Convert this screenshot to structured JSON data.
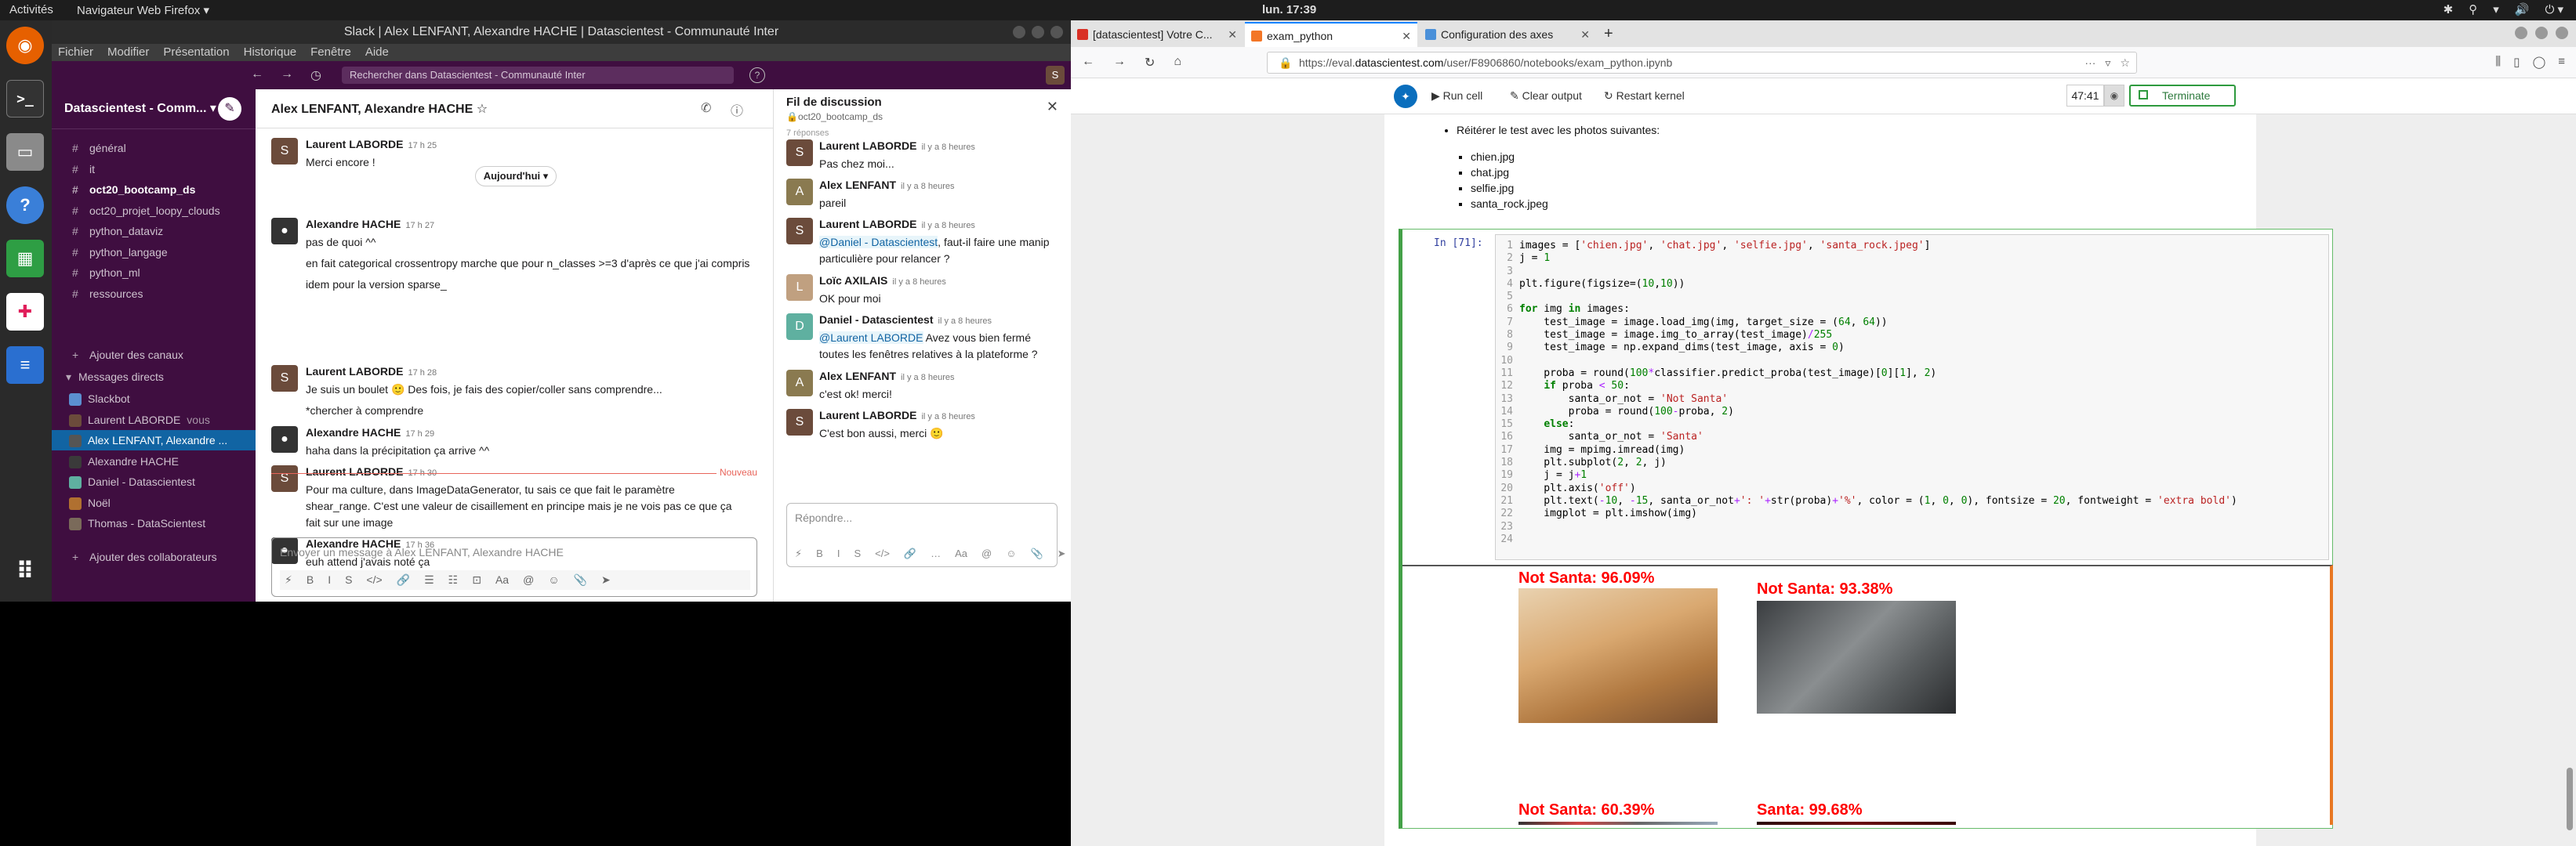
{
  "topbar": {
    "activities": "Activités",
    "app_menu": "Navigateur Web Firefox ▾",
    "clock": "lun. 17:39",
    "tray": [
      "✱",
      "⚲",
      "▾",
      "🔊",
      "⏻ ▾"
    ]
  },
  "dock": {
    "icons": [
      "firefox-icon",
      "terminal-icon",
      "files-icon",
      "help-icon",
      "spreadsheet-icon",
      "slack-icon",
      "document-icon",
      "apps-grid-icon"
    ]
  },
  "slack": {
    "window_title": "Slack | Alex LENFANT, Alexandre HACHE | Datascientest - Communauté Inter",
    "menu": [
      "Fichier",
      "Modifier",
      "Présentation",
      "Historique",
      "Fenêtre",
      "Aide"
    ],
    "search_placeholder": "Rechercher dans Datascientest - Communauté Inter",
    "help": "?",
    "user_avatar": "S",
    "workspace": "Datascientest - Comm...",
    "channels": [
      {
        "label": "général",
        "bold": false
      },
      {
        "label": "it",
        "bold": false
      },
      {
        "label": "oct20_bootcamp_ds",
        "bold": true
      },
      {
        "label": "oct20_projet_loopy_clouds",
        "bold": false
      },
      {
        "label": "python_dataviz",
        "bold": false
      },
      {
        "label": "python_langage",
        "bold": false
      },
      {
        "label": "python_ml",
        "bold": false
      },
      {
        "label": "ressources",
        "bold": false
      }
    ],
    "add_channels": "Ajouter des canaux",
    "dm_section": "Messages directs",
    "dms": [
      {
        "label": "Slackbot",
        "suffix": "",
        "active": false,
        "color": "#5b8fd0"
      },
      {
        "label": "Laurent LABORDE",
        "suffix": "vous",
        "active": false,
        "color": "#6b4b3b"
      },
      {
        "label": "Alex LENFANT, Alexandre ...",
        "suffix": "",
        "active": true,
        "color": "#555"
      },
      {
        "label": "Alexandre HACHE",
        "suffix": "",
        "active": false,
        "color": "#3a3a3a"
      },
      {
        "label": "Daniel - Datascientest",
        "suffix": "",
        "active": false,
        "color": "#5fb0a0"
      },
      {
        "label": "Noël",
        "suffix": "",
        "active": false,
        "color": "#b07030"
      },
      {
        "label": "Thomas - DataScientest",
        "suffix": "",
        "active": false,
        "color": "#7a6a5a"
      }
    ],
    "add_collaborators": "Ajouter des collaborateurs",
    "channel_title": "Alex LENFANT, Alexandre HACHE",
    "day_pill": "Aujourd'hui ▾",
    "messages": [
      {
        "name": "Laurent LABORDE",
        "time": "17 h 25",
        "lines": [
          "Merci encore !"
        ],
        "avatar": "S",
        "color": "#6b4b3b"
      },
      {
        "name": "Alexandre HACHE",
        "time": "17 h 27",
        "lines": [
          "pas de quoi ^^",
          "",
          "en fait categorical crossentropy marche que pour n_classes >=3 d'après ce que j'ai compris",
          "",
          "idem pour la version sparse_"
        ],
        "avatar": "●",
        "color": "#333"
      },
      {
        "name": "Laurent LABORDE",
        "time": "17 h 28",
        "lines": [
          "Je suis un boulet 🙂 Des fois, je fais des copier/coller sans comprendre...",
          "",
          "*chercher à comprendre"
        ],
        "avatar": "S",
        "color": "#6b4b3b"
      },
      {
        "name": "Alexandre HACHE",
        "time": "17 h 29",
        "lines": [
          "haha dans la précipitation ça arrive ^^"
        ],
        "avatar": "●",
        "color": "#333"
      },
      {
        "name": "Laurent LABORDE",
        "time": "17 h 30",
        "lines": [
          "Pour ma culture, dans ImageDataGenerator, tu sais ce que fait le paramètre",
          "shear_range. C'est une valeur de cisaillement en principe mais je ne vois pas ce que ça",
          "fait sur une image"
        ],
        "avatar": "S",
        "color": "#6b4b3b"
      },
      {
        "name": "Alexandre HACHE",
        "time": "17 h 36",
        "lines": [
          "euh attend j'avais noté ça"
        ],
        "avatar": "●",
        "color": "#333"
      }
    ],
    "new_label": "Nouveau",
    "composer_placeholder": "Envoyer un message à Alex LENFANT, Alexandre HACHE",
    "composer_tools": [
      "⚡",
      "B",
      "I",
      "S",
      "</>",
      "🔗",
      "☰",
      "☷",
      "⊡",
      "Aa",
      "@",
      "☺",
      "📎",
      "➤"
    ],
    "thread_title": "Fil de discussion",
    "thread_channel": "🔒oct20_bootcamp_ds",
    "thread_replies": "7 réponses",
    "thread": [
      {
        "name": "Laurent LABORDE",
        "time": "il y a 8 heures",
        "text": "Pas chez moi...",
        "avatar": "S",
        "color": "#6b4b3b"
      },
      {
        "name": "Alex LENFANT",
        "time": "il y a 8 heures",
        "text": "pareil",
        "avatar": "A",
        "color": "#8a7a50"
      },
      {
        "name": "Laurent LABORDE",
        "time": "il y a 8 heures",
        "mention": "@Daniel - Datascientest",
        "text": ", faut-il faire une manip particulière pour relancer ?",
        "avatar": "S",
        "color": "#6b4b3b"
      },
      {
        "name": "Loïc AXILAIS",
        "time": "il y a 8 heures",
        "text": "OK pour moi",
        "avatar": "L",
        "color": "#c0a080"
      },
      {
        "name": "Daniel - Datascientest",
        "time": "il y a 8 heures",
        "mention": "@Laurent LABORDE",
        "text": " Avez vous bien fermé toutes les fenêtres relatives à la plateforme ?",
        "avatar": "D",
        "color": "#5fb0a0"
      },
      {
        "name": "Alex LENFANT",
        "time": "il y a 8 heures",
        "text": "c'est ok! merci!",
        "avatar": "A",
        "color": "#8a7a50"
      },
      {
        "name": "Laurent LABORDE",
        "time": "il y a 8 heures",
        "text": "C'est bon aussi, merci 🙂",
        "avatar": "S",
        "color": "#6b4b3b"
      }
    ],
    "reply_placeholder": "Répondre..."
  },
  "firefox": {
    "tabs": [
      {
        "label": "[datascientest] Votre C...",
        "active": false,
        "color": "#d93025"
      },
      {
        "label": "exam_python",
        "active": true,
        "color": "#f37626"
      },
      {
        "label": "Configuration des axes",
        "active": false,
        "color": "#4a90d9"
      }
    ],
    "url_prefix": "https://eval.",
    "url_domain": "datascientest.com",
    "url_suffix": "/user/F8906860/notebooks/exam_python.ipynb",
    "toolbar": {
      "run": "▶ Run cell",
      "clear": "✎ Clear output",
      "restart": "↻ Restart kernel",
      "timer": "47:41",
      "terminate": "Terminate"
    },
    "markdown_intro": "Réitérer le test avec les photos suivantes:",
    "markdown_files": [
      "chien.jpg",
      "chat.jpg",
      "selfie.jpg",
      "santa_rock.jpeg"
    ],
    "prompt": "In [71]:",
    "line_numbers": [
      "1",
      "2",
      "3",
      "4",
      "5",
      "6",
      "7",
      "8",
      "9",
      "10",
      "11",
      "12",
      "13",
      "14",
      "15",
      "16",
      "17",
      "18",
      "19",
      "20",
      "21",
      "22",
      "23",
      "24"
    ],
    "plots": [
      {
        "title": "Not Santa: 96.09%",
        "img_color": "#c08a50",
        "subject": "dog"
      },
      {
        "title": "Not Santa: 93.38%",
        "img_color": "#6a6e70",
        "subject": "cat"
      },
      {
        "title": "Not Santa: 60.39%",
        "img_color": "#444",
        "subject": "selfie"
      },
      {
        "title": "Santa: 99.68%",
        "img_color": "#5a1010",
        "subject": "santa"
      }
    ]
  }
}
